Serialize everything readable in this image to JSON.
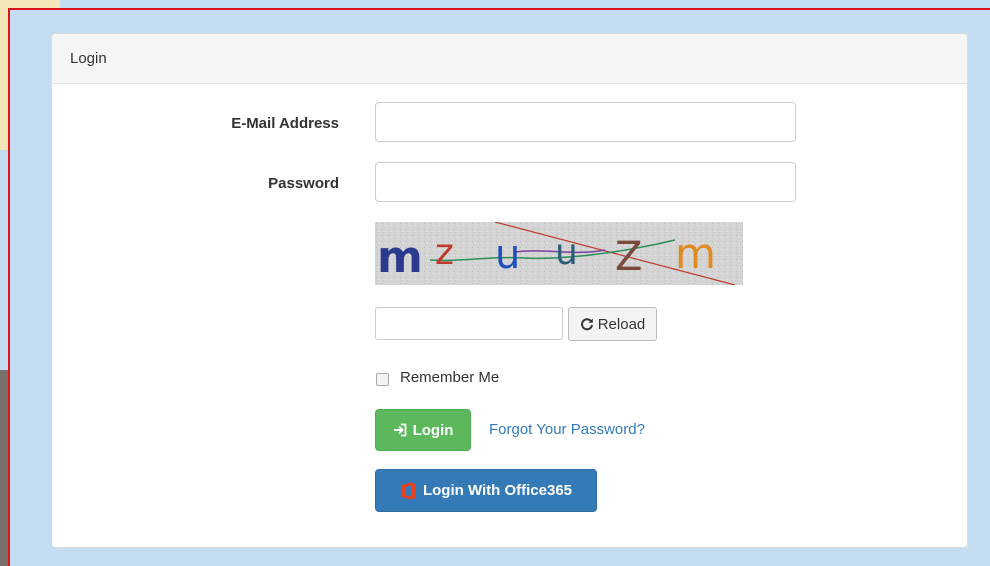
{
  "panel": {
    "heading": "Login"
  },
  "form": {
    "email_label": "E-Mail Address",
    "email_value": "",
    "password_label": "Password",
    "password_value": "",
    "captcha_text": "mzuuzm",
    "captcha_input_value": "",
    "reload_label": "Reload",
    "remember_label": "Remember Me",
    "remember_checked": false,
    "login_label": "Login",
    "forgot_label": "Forgot Your Password?",
    "office_label": "Login With Office365"
  },
  "icons": {
    "reload": "refresh-icon",
    "login": "sign-in-icon",
    "office": "office365-icon"
  },
  "colors": {
    "success": "#5cb85c",
    "primary": "#337ab7",
    "link": "#337ab7",
    "frame": "#d9161c",
    "page_bg": "#c5ddf3"
  }
}
